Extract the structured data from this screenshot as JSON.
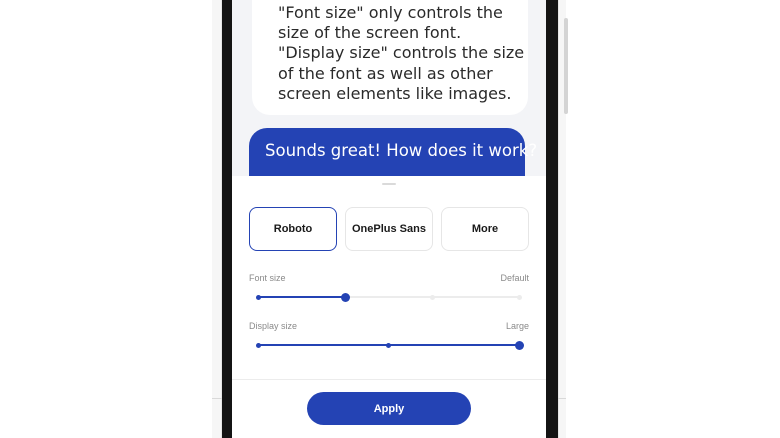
{
  "conversation": {
    "incoming_text": "\"Font size\" only controls the size of the screen font. \"Display size\" controls the size of the font as well as other screen elements like images.",
    "outgoing_text": "Sounds great! How does it work?"
  },
  "font_options": [
    "Roboto",
    "OnePlus Sans",
    "More"
  ],
  "selected_font": "Roboto",
  "font_size": {
    "label": "Font size",
    "value_label": "Default",
    "steps": 4,
    "selected_step": 1
  },
  "display_size": {
    "label": "Display size",
    "value_label": "Large",
    "steps": 3,
    "selected_step": 2
  },
  "apply_label": "Apply",
  "colors": {
    "accent": "#2443b4",
    "track_inactive": "#ececec",
    "text_secondary": "#8a8a8a"
  }
}
